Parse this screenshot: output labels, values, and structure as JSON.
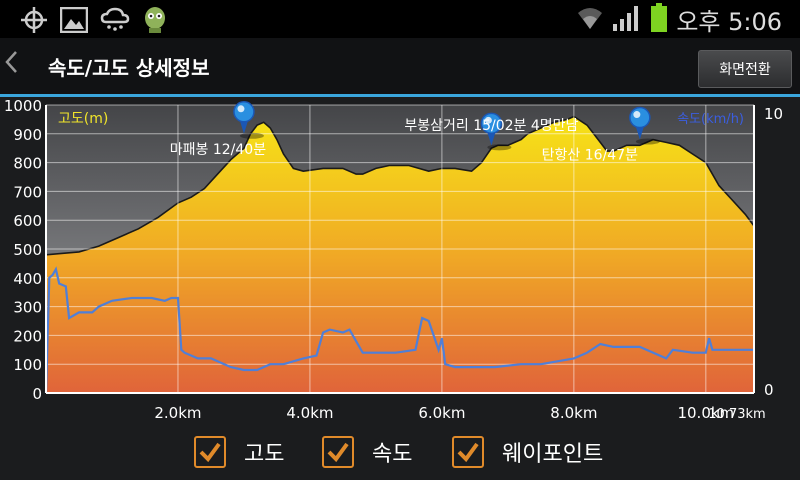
{
  "status_bar": {
    "time": "오후 5:06",
    "icons": [
      "gps-icon",
      "image-icon",
      "weather-icon",
      "app-icon",
      "wifi-icon",
      "signal-icon",
      "battery-icon"
    ]
  },
  "header": {
    "back_icon": "chevron-left-icon",
    "title": "속도/고도 상세정보",
    "toggle_label": "화면전환"
  },
  "colors": {
    "accent": "#3aa6dd",
    "elevation_top": "#f6e317",
    "elevation_bottom": "#e0643a",
    "speed_line": "#4f7fd8",
    "checkbox": "#e08a2a"
  },
  "chart_data": {
    "type": "area",
    "xunit": "km",
    "xlim": [
      0,
      10.73
    ],
    "x_ticks": [
      "2.0km",
      "4.0km",
      "6.0km",
      "8.0km",
      "10.0km"
    ],
    "x_tick_values": [
      2,
      4,
      6,
      8,
      10
    ],
    "x_end_label": "10.73km",
    "grid": true,
    "left_axis": {
      "label": "고도(m)",
      "ylim": [
        0,
        1000
      ],
      "ticks": [
        0,
        100,
        200,
        300,
        400,
        500,
        600,
        700,
        800,
        900,
        1000
      ]
    },
    "right_axis": {
      "label": "속도(km/h)",
      "ylim": [
        0,
        10
      ],
      "ticks": [
        0,
        10
      ]
    },
    "series": [
      {
        "name": "고도",
        "axis": "left",
        "x": [
          0,
          0.5,
          0.8,
          1.1,
          1.4,
          1.7,
          2.0,
          2.2,
          2.4,
          2.6,
          2.8,
          3.0,
          3.1,
          3.2,
          3.3,
          3.4,
          3.5,
          3.6,
          3.75,
          3.9,
          4.2,
          4.5,
          4.7,
          4.8,
          5.0,
          5.2,
          5.5,
          5.8,
          6.0,
          6.2,
          6.45,
          6.6,
          6.75,
          6.85,
          7.0,
          7.2,
          7.3,
          7.5,
          7.7,
          7.9,
          8.0,
          8.2,
          8.4,
          8.5,
          8.6,
          8.8,
          9.0,
          9.2,
          9.4,
          9.6,
          9.8,
          10.0,
          10.2,
          10.4,
          10.6,
          10.73
        ],
        "values": [
          480,
          490,
          510,
          540,
          570,
          610,
          660,
          680,
          710,
          760,
          810,
          850,
          900,
          930,
          940,
          920,
          880,
          830,
          780,
          770,
          780,
          780,
          760,
          760,
          780,
          790,
          790,
          770,
          780,
          780,
          770,
          800,
          850,
          860,
          860,
          880,
          900,
          920,
          940,
          950,
          960,
          930,
          870,
          840,
          840,
          860,
          860,
          880,
          870,
          860,
          830,
          800,
          720,
          670,
          620,
          580
        ]
      },
      {
        "name": "속도",
        "axis": "right",
        "x": [
          0,
          0.05,
          0.1,
          0.15,
          0.2,
          0.3,
          0.35,
          0.5,
          0.7,
          0.8,
          1.0,
          1.3,
          1.6,
          1.8,
          1.9,
          2.0,
          2.05,
          2.1,
          2.3,
          2.5,
          2.8,
          3.0,
          3.2,
          3.4,
          3.6,
          3.9,
          4.1,
          4.2,
          4.3,
          4.5,
          4.6,
          4.8,
          5.0,
          5.3,
          5.6,
          5.7,
          5.8,
          5.95,
          6.0,
          6.05,
          6.2,
          6.5,
          6.8,
          7.2,
          7.5,
          8.0,
          8.2,
          8.4,
          8.6,
          8.8,
          9.0,
          9.4,
          9.5,
          9.8,
          10.0,
          10.05,
          10.1,
          10.3,
          10.5,
          10.73
        ],
        "values": [
          0,
          4.0,
          4.1,
          4.3,
          3.8,
          3.7,
          2.6,
          2.8,
          2.8,
          3.0,
          3.2,
          3.3,
          3.3,
          3.2,
          3.3,
          3.3,
          1.5,
          1.4,
          1.2,
          1.2,
          0.9,
          0.8,
          0.8,
          1.0,
          1.0,
          1.2,
          1.3,
          2.1,
          2.2,
          2.1,
          2.2,
          1.4,
          1.4,
          1.4,
          1.5,
          2.6,
          2.5,
          1.5,
          1.9,
          1.0,
          0.9,
          0.9,
          0.9,
          1.0,
          1.0,
          1.2,
          1.4,
          1.7,
          1.6,
          1.6,
          1.6,
          1.2,
          1.5,
          1.4,
          1.4,
          1.9,
          1.5,
          1.5,
          1.5,
          1.5
        ]
      }
    ],
    "waypoints": [
      {
        "label": "마패봉 12/40분",
        "x": 3.0,
        "y": 900
      },
      {
        "label": "부봉삼거리 15/02분 4명만남",
        "x": 6.75,
        "y": 860
      },
      {
        "label": "탄항산 16/47분",
        "x": 9.0,
        "y": 880
      }
    ]
  },
  "legend": {
    "items": [
      {
        "label": "고도",
        "checked": true
      },
      {
        "label": "속도",
        "checked": true
      },
      {
        "label": "웨이포인트",
        "checked": true
      }
    ]
  }
}
